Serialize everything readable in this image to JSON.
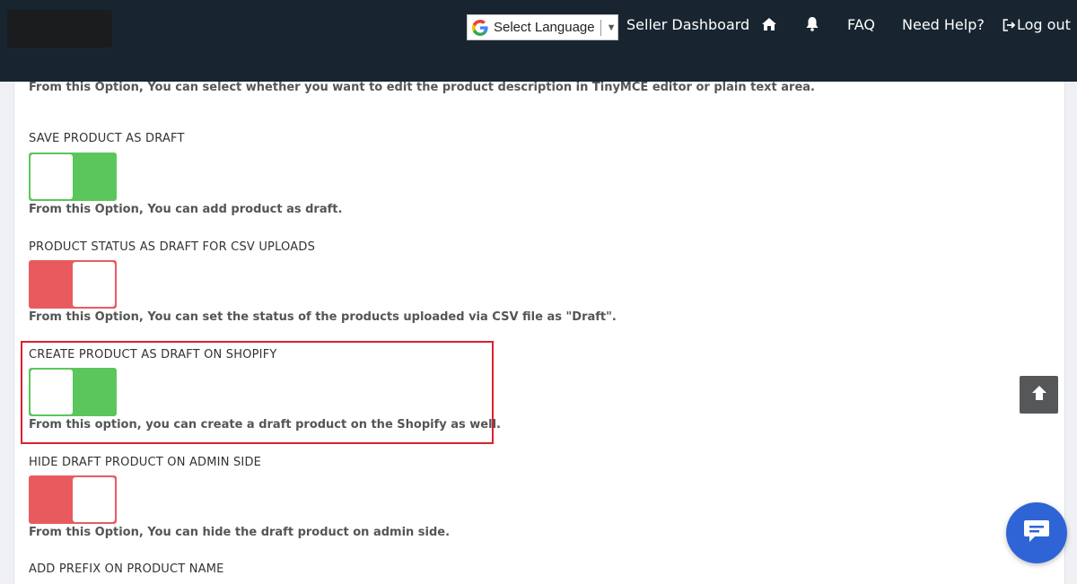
{
  "header": {
    "language_selector": {
      "label": "Select Language",
      "arrow": "▼",
      "icon": "google-g-icon"
    },
    "nav": {
      "seller_dashboard": "Seller Dashboard",
      "home_icon": "home-icon",
      "notifications_icon": "bell-icon",
      "faq": "FAQ",
      "need_help": "Need Help?",
      "logout": "Log out",
      "logout_icon": "logout-icon"
    }
  },
  "settings": {
    "top_description": "From this Option, You can select whether you want to edit the product description in TinyMCE editor or plain text area.",
    "options": [
      {
        "label": "SAVE PRODUCT AS DRAFT",
        "state": "on",
        "description": "From this Option, You can add product as draft."
      },
      {
        "label": "PRODUCT STATUS AS DRAFT FOR CSV UPLOADS",
        "state": "off",
        "description": "From this Option, You can set the status of the products uploaded via CSV file as \"Draft\"."
      },
      {
        "label": "CREATE PRODUCT AS DRAFT ON SHOPIFY",
        "state": "on",
        "description": "From this option, you can create a draft product on the Shopify as well.",
        "highlighted": true
      },
      {
        "label": "HIDE DRAFT PRODUCT ON ADMIN SIDE",
        "state": "off",
        "description": "From this Option, You can hide the draft product on admin side."
      },
      {
        "label": "ADD PREFIX ON PRODUCT NAME"
      }
    ]
  },
  "colors": {
    "header_bg": "#182531",
    "toggle_on": "#5bc65b",
    "toggle_off": "#e95a5f",
    "highlight_border": "#d9232d",
    "chat_button": "#2f64d6"
  },
  "floating": {
    "scroll_top_icon": "arrow-up-icon",
    "chat_icon": "chat-bubble-icon"
  }
}
